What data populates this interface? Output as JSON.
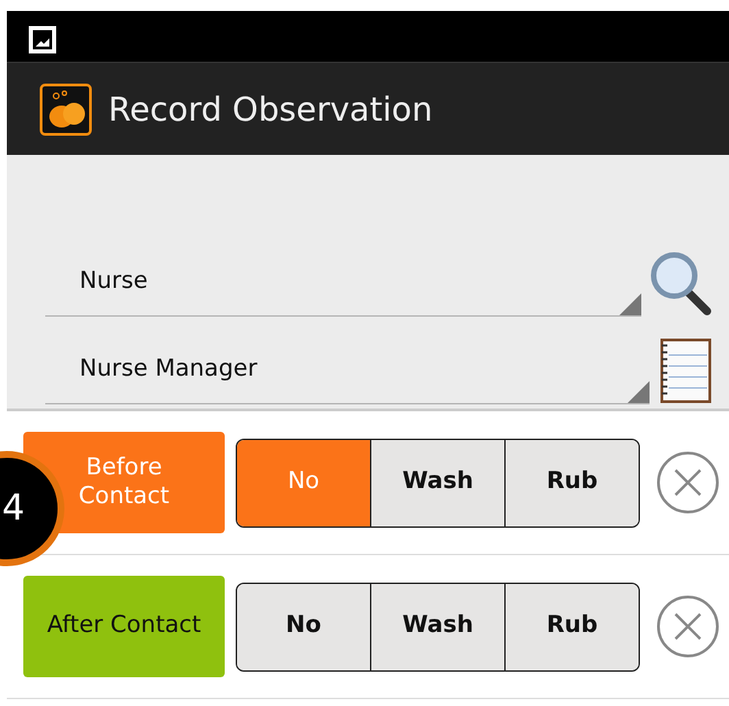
{
  "action_bar": {
    "title": "Record Observation"
  },
  "fields": [
    {
      "kind": "search",
      "value": "Nurse"
    },
    {
      "kind": "list",
      "value": "Nurse Manager"
    }
  ],
  "moments": [
    {
      "label": "Before Contact",
      "color": "#fb7318",
      "options": [
        {
          "label": "No",
          "selected": true
        },
        {
          "label": "Wash",
          "selected": false
        },
        {
          "label": "Rub",
          "selected": false
        }
      ]
    },
    {
      "label": "After Contact",
      "color": "#8fc10e",
      "options": [
        {
          "label": "No",
          "selected": false
        },
        {
          "label": "Wash",
          "selected": false
        },
        {
          "label": "Rub",
          "selected": false
        }
      ]
    }
  ],
  "step_badge": {
    "text": "4"
  }
}
